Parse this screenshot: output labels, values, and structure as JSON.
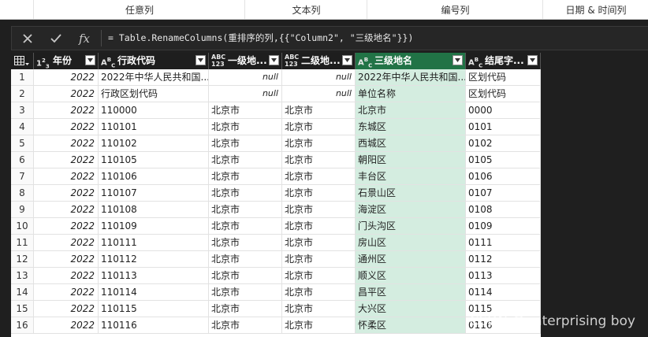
{
  "ribbon": {
    "groups": [
      "",
      "任意列",
      "文本列",
      "编号列",
      "日期 & 时间列"
    ]
  },
  "formula_bar": {
    "cancel_icon": "close-icon",
    "commit_icon": "check-icon",
    "fx_label": "fx",
    "formula": "= Table.RenameColumns(重排序的列,{{\"Column2\", \"三级地名\"}})"
  },
  "table": {
    "selected_column": 5,
    "selected_color": "#217346",
    "selected_cell_color": "#d4ede0",
    "columns": [
      {
        "type": "table-icon",
        "label": ""
      },
      {
        "type": "123",
        "label": "年份"
      },
      {
        "type": "ABC",
        "label": "行政代码"
      },
      {
        "type": "ABC123",
        "label": "一级地..."
      },
      {
        "type": "ABC123",
        "label": "二级地..."
      },
      {
        "type": "ABC",
        "label": "三级地名"
      },
      {
        "type": "ABC",
        "label": "结尾字..."
      }
    ],
    "rows": [
      [
        "1",
        "2022",
        "2022年中华人民共和国...",
        "null",
        "null",
        "2022年中华人民共和国...",
        "区划代码"
      ],
      [
        "2",
        "2022",
        "行政区划代码",
        "null",
        "null",
        "单位名称",
        "区划代码"
      ],
      [
        "3",
        "2022",
        "110000",
        "北京市",
        "北京市",
        "北京市",
        "0000"
      ],
      [
        "4",
        "2022",
        "110101",
        "北京市",
        "北京市",
        "东城区",
        "0101"
      ],
      [
        "5",
        "2022",
        "110102",
        "北京市",
        "北京市",
        "西城区",
        "0102"
      ],
      [
        "6",
        "2022",
        "110105",
        "北京市",
        "北京市",
        "朝阳区",
        "0105"
      ],
      [
        "7",
        "2022",
        "110106",
        "北京市",
        "北京市",
        "丰台区",
        "0106"
      ],
      [
        "8",
        "2022",
        "110107",
        "北京市",
        "北京市",
        "石景山区",
        "0107"
      ],
      [
        "9",
        "2022",
        "110108",
        "北京市",
        "北京市",
        "海淀区",
        "0108"
      ],
      [
        "10",
        "2022",
        "110109",
        "北京市",
        "北京市",
        "门头沟区",
        "0109"
      ],
      [
        "11",
        "2022",
        "110111",
        "北京市",
        "北京市",
        "房山区",
        "0111"
      ],
      [
        "12",
        "2022",
        "110112",
        "北京市",
        "北京市",
        "通州区",
        "0112"
      ],
      [
        "13",
        "2022",
        "110113",
        "北京市",
        "北京市",
        "顺义区",
        "0113"
      ],
      [
        "14",
        "2022",
        "110114",
        "北京市",
        "北京市",
        "昌平区",
        "0114"
      ],
      [
        "15",
        "2022",
        "110115",
        "北京市",
        "北京市",
        "大兴区",
        "0115"
      ],
      [
        "16",
        "2022",
        "110116",
        "北京市",
        "北京市",
        "怀柔区",
        "0116"
      ]
    ]
  },
  "watermark": "CSDN @enterprising boy"
}
